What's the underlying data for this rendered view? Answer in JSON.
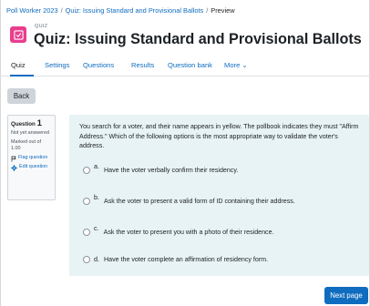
{
  "breadcrumb": [
    "Poll Worker 2023",
    "Quiz: Issuing Standard and Provisional Ballots",
    "Preview"
  ],
  "header": {
    "label": "QUIZ",
    "title": "Quiz: Issuing Standard and Provisional Ballots"
  },
  "tabs": [
    {
      "label": "Quiz",
      "active": true
    },
    {
      "label": "Settings"
    },
    {
      "label": "Questions"
    },
    {
      "label": "Results"
    },
    {
      "label": "Question bank"
    },
    {
      "label": "More ⌄"
    }
  ],
  "back_label": "Back",
  "question_info": {
    "label": "Question",
    "number": "1",
    "status": "Not yet answered",
    "marks_label": "Marked out of",
    "marks": "1.00",
    "flag_label": "Flag question",
    "edit_label": "Edit question"
  },
  "question": {
    "text": "You search for a voter, and their name appears in yellow. The pollbook indicates they must \"Affirm Address.\" Which of the following options is the most appropriate way to validate the voter's address.",
    "options": [
      {
        "letter": "a.",
        "text": "Have the voter verbally confirm their residency."
      },
      {
        "letter": "b.",
        "text": "Ask the voter to present a valid form of ID containing their address."
      },
      {
        "letter": "c.",
        "text": "Ask the voter to present you with a photo of their residence."
      },
      {
        "letter": "d.",
        "text": "Have the voter complete an affirmation of residency form."
      }
    ]
  },
  "next_label": "Next page",
  "colors": {
    "accent": "#0f6cbf",
    "quiz_icon": "#e83e8c",
    "content_bg": "#e7f3f5"
  }
}
